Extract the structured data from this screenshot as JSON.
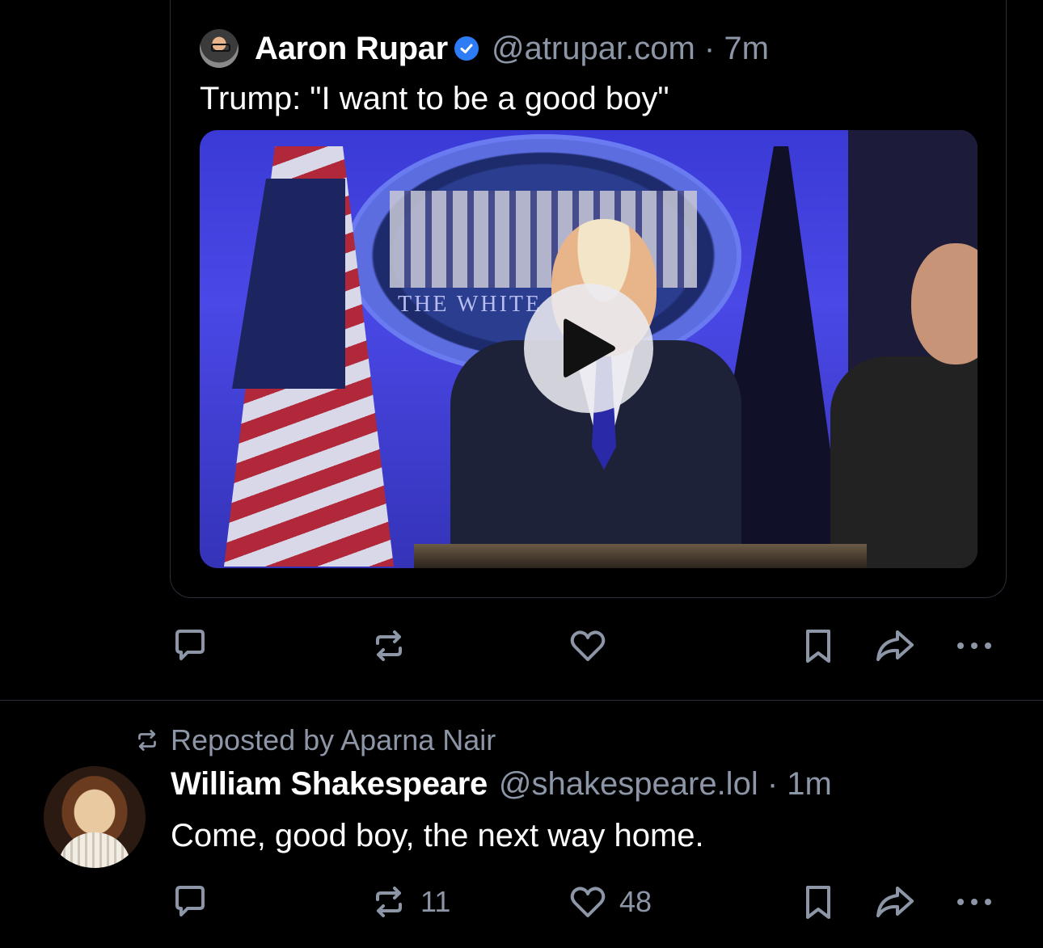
{
  "quoted_post": {
    "author_name": "Aaron Rupar",
    "handle_time": "@atrupar.com · 7m",
    "text": "Trump: \"I want to be a good boy\"",
    "video_overlay_text": "THE WHITE",
    "video_alt": "Video of Trump at podium in the White House briefing room"
  },
  "first_post_actions": {
    "reply_count": "",
    "repost_count": "",
    "like_count": ""
  },
  "second_post": {
    "repost_label": "Reposted by Aparna Nair",
    "author_name": "William Shakespeare",
    "handle_time": "@shakespeare.lol · 1m",
    "text": "Come, good boy, the next way home.",
    "reply_count": "",
    "repost_count": "11",
    "like_count": "48"
  },
  "colors": {
    "background": "#000000",
    "text": "#ffffff",
    "muted": "#8d96a7",
    "verified": "#2d7cf6",
    "border": "#2a2f3a"
  }
}
